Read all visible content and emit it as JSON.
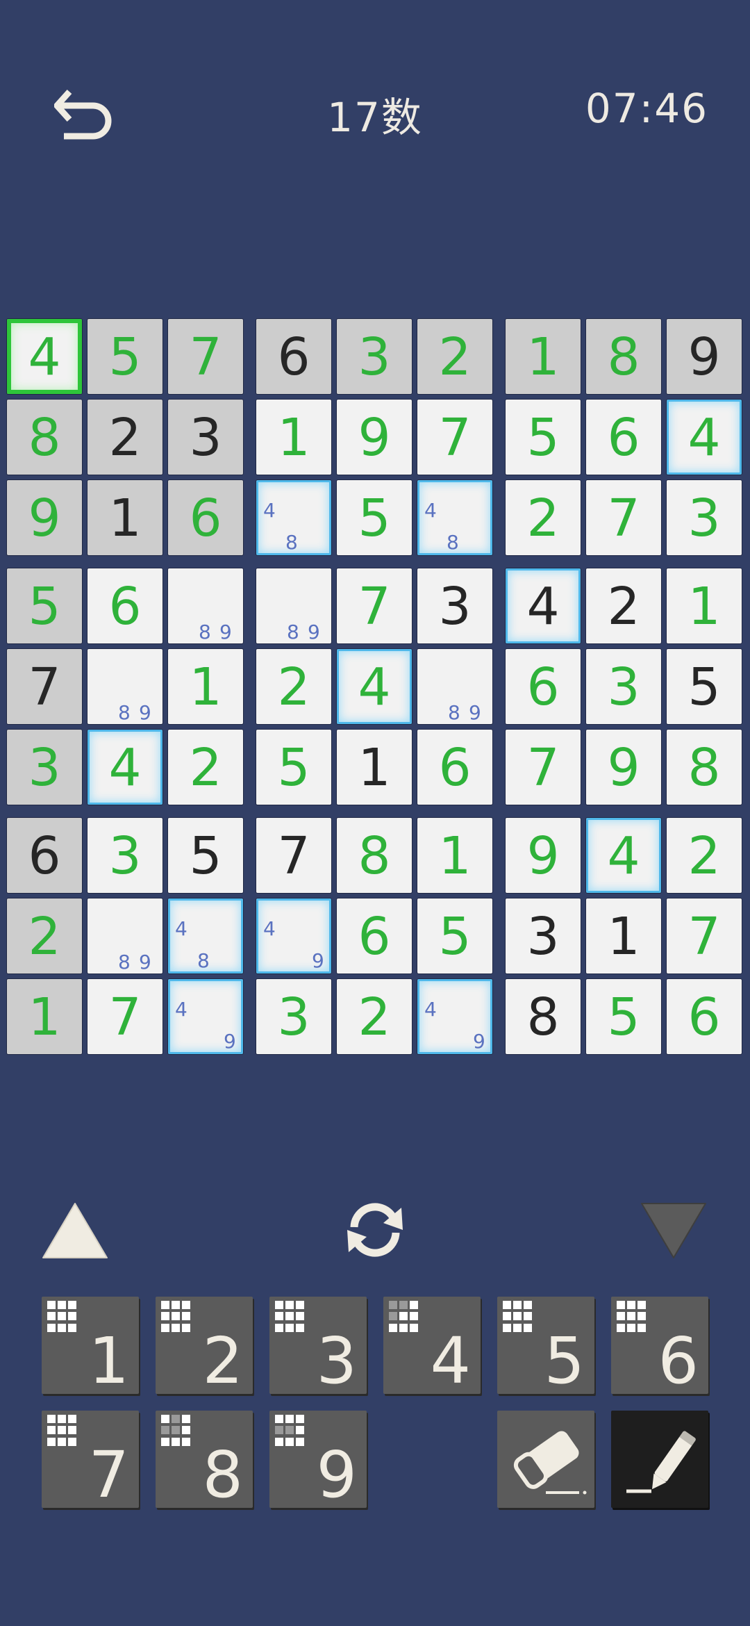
{
  "header": {
    "title": "17数",
    "timer": "07:46",
    "back_icon": "undo-arrow-icon"
  },
  "board": {
    "rows": [
      [
        {
          "v": "4",
          "c": "green",
          "given": false,
          "sel": true
        },
        {
          "v": "5",
          "c": "green",
          "given": true
        },
        {
          "v": "7",
          "c": "green",
          "given": true
        },
        {
          "v": "6",
          "c": "black",
          "given": true
        },
        {
          "v": "3",
          "c": "green",
          "given": true
        },
        {
          "v": "2",
          "c": "green",
          "given": true
        },
        {
          "v": "1",
          "c": "green",
          "given": true
        },
        {
          "v": "8",
          "c": "green",
          "given": true
        },
        {
          "v": "9",
          "c": "black",
          "given": true
        }
      ],
      [
        {
          "v": "8",
          "c": "green",
          "given": true
        },
        {
          "v": "2",
          "c": "black",
          "given": true
        },
        {
          "v": "3",
          "c": "black",
          "given": true
        },
        {
          "v": "1",
          "c": "green"
        },
        {
          "v": "9",
          "c": "green"
        },
        {
          "v": "7",
          "c": "green"
        },
        {
          "v": "5",
          "c": "green"
        },
        {
          "v": "6",
          "c": "green"
        },
        {
          "v": "4",
          "c": "green",
          "hl": true
        }
      ],
      [
        {
          "v": "9",
          "c": "green",
          "given": true
        },
        {
          "v": "1",
          "c": "black",
          "given": true
        },
        {
          "v": "6",
          "c": "green",
          "given": true
        },
        {
          "notes": [
            "4",
            "8"
          ],
          "style": "diag",
          "hl": true
        },
        {
          "v": "5",
          "c": "green"
        },
        {
          "notes": [
            "4",
            "8"
          ],
          "style": "diag",
          "hl": true
        },
        {
          "v": "2",
          "c": "green"
        },
        {
          "v": "7",
          "c": "green"
        },
        {
          "v": "3",
          "c": "green"
        }
      ],
      [
        {
          "v": "5",
          "c": "green",
          "given": true
        },
        {
          "v": "6",
          "c": "green"
        },
        {
          "notes": [
            "8",
            "9"
          ],
          "style": "bottom"
        },
        {
          "notes": [
            "8",
            "9"
          ],
          "style": "bottom"
        },
        {
          "v": "7",
          "c": "green"
        },
        {
          "v": "3",
          "c": "black"
        },
        {
          "v": "4",
          "c": "black",
          "hl": true
        },
        {
          "v": "2",
          "c": "black"
        },
        {
          "v": "1",
          "c": "green"
        }
      ],
      [
        {
          "v": "7",
          "c": "black",
          "given": true
        },
        {
          "notes": [
            "8",
            "9"
          ],
          "style": "bottom"
        },
        {
          "v": "1",
          "c": "green"
        },
        {
          "v": "2",
          "c": "green"
        },
        {
          "v": "4",
          "c": "green",
          "hl": true
        },
        {
          "notes": [
            "8",
            "9"
          ],
          "style": "bottom"
        },
        {
          "v": "6",
          "c": "green"
        },
        {
          "v": "3",
          "c": "green"
        },
        {
          "v": "5",
          "c": "black"
        }
      ],
      [
        {
          "v": "3",
          "c": "green",
          "given": true
        },
        {
          "v": "4",
          "c": "green",
          "hl": true
        },
        {
          "v": "2",
          "c": "green"
        },
        {
          "v": "5",
          "c": "green"
        },
        {
          "v": "1",
          "c": "black"
        },
        {
          "v": "6",
          "c": "green"
        },
        {
          "v": "7",
          "c": "green"
        },
        {
          "v": "9",
          "c": "green"
        },
        {
          "v": "8",
          "c": "green"
        }
      ],
      [
        {
          "v": "6",
          "c": "black",
          "given": true
        },
        {
          "v": "3",
          "c": "green"
        },
        {
          "v": "5",
          "c": "black"
        },
        {
          "v": "7",
          "c": "black"
        },
        {
          "v": "8",
          "c": "green"
        },
        {
          "v": "1",
          "c": "green"
        },
        {
          "v": "9",
          "c": "green"
        },
        {
          "v": "4",
          "c": "green",
          "hl": true
        },
        {
          "v": "2",
          "c": "green"
        }
      ],
      [
        {
          "v": "2",
          "c": "green",
          "given": true
        },
        {
          "notes": [
            "8",
            "9"
          ],
          "style": "bottom"
        },
        {
          "notes": [
            "4",
            "8"
          ],
          "style": "diag",
          "hl": true
        },
        {
          "notes": [
            "4",
            "9"
          ],
          "style": "corner",
          "hl": true
        },
        {
          "v": "6",
          "c": "green"
        },
        {
          "v": "5",
          "c": "green"
        },
        {
          "v": "3",
          "c": "black"
        },
        {
          "v": "1",
          "c": "black"
        },
        {
          "v": "7",
          "c": "green"
        }
      ],
      [
        {
          "v": "1",
          "c": "green",
          "given": true
        },
        {
          "v": "7",
          "c": "green"
        },
        {
          "notes": [
            "4",
            "9"
          ],
          "style": "corner",
          "hl": true
        },
        {
          "v": "3",
          "c": "green"
        },
        {
          "v": "2",
          "c": "green"
        },
        {
          "notes": [
            "4",
            "9"
          ],
          "style": "corner",
          "hl": true
        },
        {
          "v": "8",
          "c": "black"
        },
        {
          "v": "5",
          "c": "green"
        },
        {
          "v": "6",
          "c": "green"
        }
      ]
    ]
  },
  "controls": {
    "prev_icon": "triangle-up-icon",
    "refresh_icon": "refresh-icon",
    "next_icon": "triangle-down-icon"
  },
  "keypad": {
    "keys": [
      {
        "label": "1",
        "remaining_off": []
      },
      {
        "label": "2",
        "remaining_off": []
      },
      {
        "label": "3",
        "remaining_off": []
      },
      {
        "label": "4",
        "remaining_off": [
          0,
          1,
          3
        ]
      },
      {
        "label": "5",
        "remaining_off": []
      },
      {
        "label": "6",
        "remaining_off": []
      },
      {
        "label": "7",
        "remaining_off": []
      },
      {
        "label": "8",
        "remaining_off": [
          1,
          3,
          4
        ]
      },
      {
        "label": "9",
        "remaining_off": [
          3,
          4
        ]
      }
    ],
    "eraser_icon": "eraser-icon",
    "pencil_icon": "pencil-icon"
  },
  "colors": {
    "background": "#323f66",
    "green_digit": "#2fb23a",
    "black_digit": "#262626",
    "note_digit": "#5a72c0",
    "highlight": "#4fb8ea",
    "selected": "#2ec53a"
  }
}
